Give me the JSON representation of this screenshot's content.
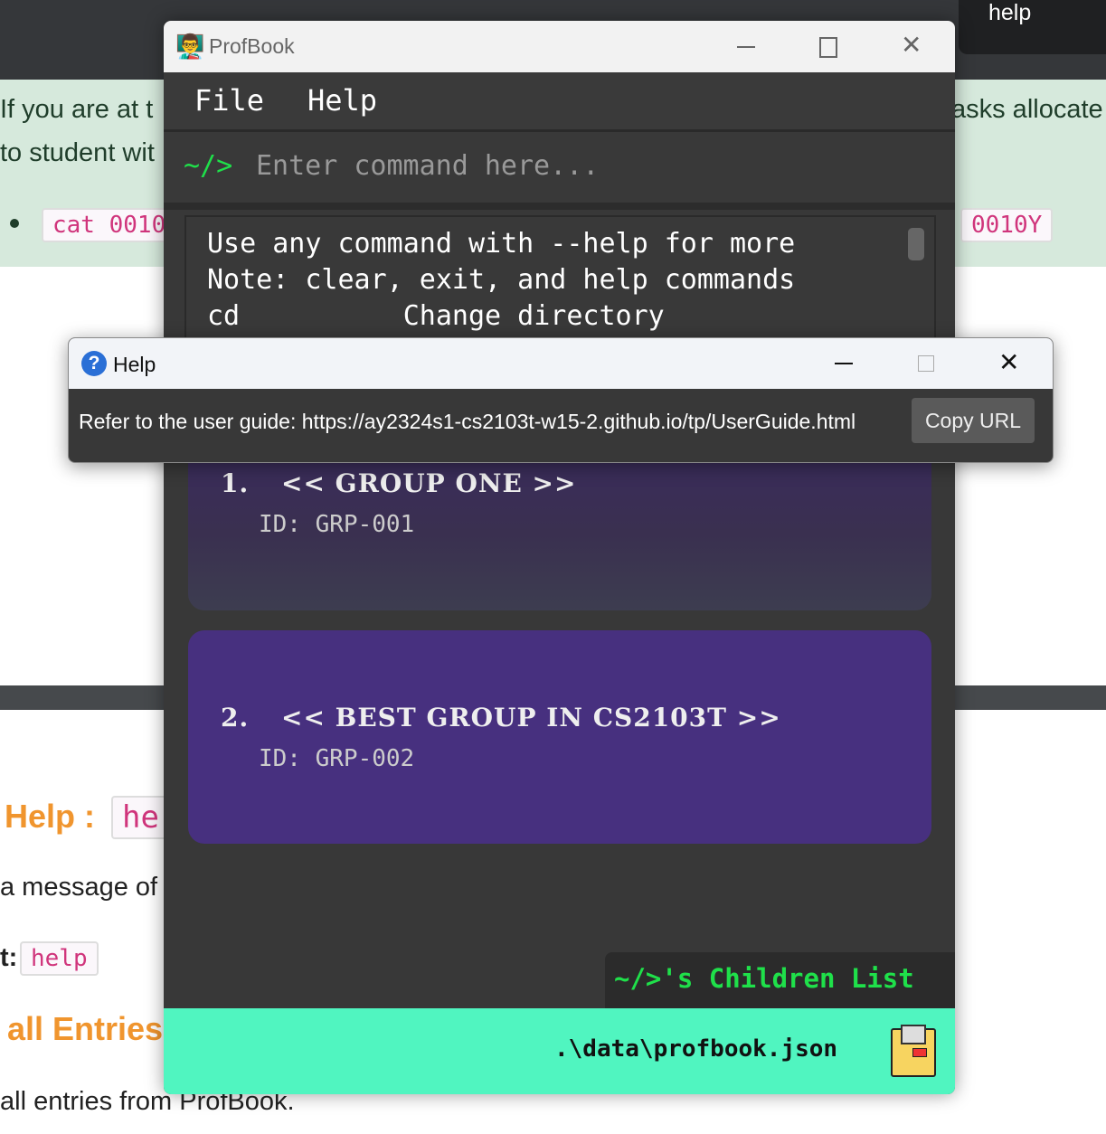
{
  "background": {
    "top_right_label": "help",
    "line1_left": "If you are at t",
    "line1_right": "asks allocate",
    "line2_left": "to student wit",
    "code1": "cat 0010",
    "code2": "0010Y",
    "help_heading": "Help :",
    "help_code": "he",
    "message_text": "a message of",
    "format_prefix": "t:",
    "format_code": "help",
    "entries_heading": "all Entries",
    "entries_text": "all entries from ProfBook."
  },
  "profbook": {
    "title": "ProfBook",
    "menu": [
      "File",
      "Help"
    ],
    "prompt": "~/>",
    "command_placeholder": "Enter command here...",
    "result_lines": [
      "Use any command with --help for more",
      "Note: clear, exit, and help commands",
      "cd          Change directory"
    ],
    "groups": [
      {
        "index": "1.",
        "name": "<< GROUP ONE >>",
        "id": "ID: GRP-001"
      },
      {
        "index": "2.",
        "name": "<< BEST GROUP IN CS2103T >>",
        "id": "ID: GRP-002"
      }
    ],
    "children_list_label": "~/>'s Children List",
    "status_path": ".\\data\\profbook.json",
    "colors": {
      "prompt": "#1fe04a",
      "status_bar": "#50f5c0",
      "card": "#47307f"
    }
  },
  "help_dialog": {
    "title": "Help",
    "message": "Refer to the user guide: https://ay2324s1-cs2103t-w15-2.github.io/tp/UserGuide.html",
    "copy_button": "Copy URL"
  }
}
